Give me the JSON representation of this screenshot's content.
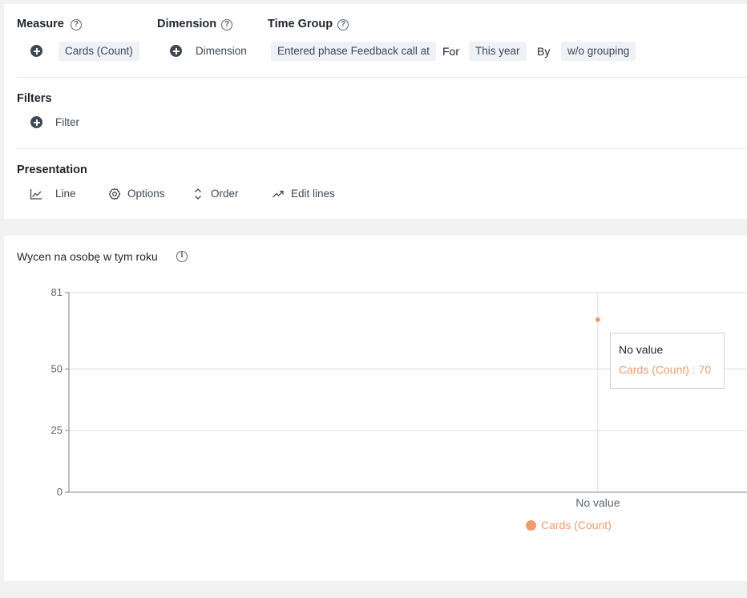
{
  "config": {
    "measure": {
      "title": "Measure",
      "add_icon": "plus-circle-icon",
      "value": "Cards (Count)"
    },
    "dimension": {
      "title": "Dimension",
      "add_label": "Dimension",
      "add_icon": "plus-circle-icon"
    },
    "time_group": {
      "title": "Time Group",
      "field": "Entered phase Feedback call at",
      "for_label": "For",
      "period": "This year",
      "by_label": "By",
      "grouping": "w/o grouping"
    },
    "filters": {
      "title": "Filters",
      "add_label": "Filter",
      "add_icon": "plus-circle-icon"
    },
    "presentation": {
      "title": "Presentation",
      "items": [
        {
          "label": "Line",
          "icon": "line-chart-icon"
        },
        {
          "label": "Options",
          "icon": "gear-icon"
        },
        {
          "label": "Order",
          "icon": "sort-icon"
        },
        {
          "label": "Edit lines",
          "icon": "trend-up-icon"
        }
      ]
    },
    "help_icon": "question-circle-icon"
  },
  "chart_panel": {
    "title": "Wycen na osobę w tym roku",
    "info_icon": "info-circle-icon",
    "tooltip": {
      "title": "No value",
      "value": "Cards (Count) : 70"
    }
  },
  "chart_data": {
    "type": "line",
    "categories": [
      "No value"
    ],
    "series": [
      {
        "name": "Cards (Count)",
        "values": [
          70
        ],
        "color": "#f09a6f"
      }
    ],
    "ylim": [
      0,
      81
    ],
    "yticks": [
      0,
      25,
      50,
      81
    ],
    "grid": true,
    "legend": "bottom"
  }
}
